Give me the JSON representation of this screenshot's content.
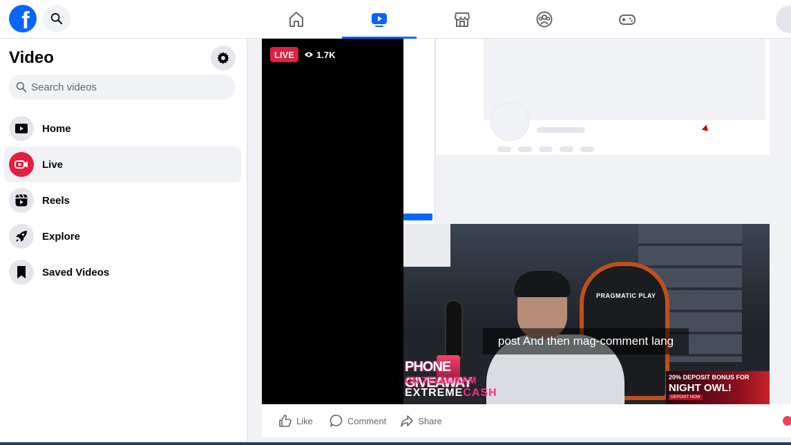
{
  "topbar": {
    "logo_letter": "f",
    "nav": [
      {
        "name": "home",
        "icon": "home-icon"
      },
      {
        "name": "video",
        "icon": "video-icon",
        "active": true
      },
      {
        "name": "marketplace",
        "icon": "marketplace-icon"
      },
      {
        "name": "groups",
        "icon": "groups-icon"
      },
      {
        "name": "gaming",
        "icon": "gaming-icon"
      }
    ],
    "accent_color": "#0866ff"
  },
  "sidebar": {
    "title": "Video",
    "search_placeholder": "Search videos",
    "items": [
      {
        "label": "Home",
        "icon": "video-home-icon"
      },
      {
        "label": "Live",
        "icon": "live-camera-icon",
        "active": true
      },
      {
        "label": "Reels",
        "icon": "reels-icon"
      },
      {
        "label": "Explore",
        "icon": "rocket-icon"
      },
      {
        "label": "Saved Videos",
        "icon": "bookmark-icon"
      }
    ]
  },
  "player": {
    "live_label": "LIVE",
    "viewer_count": "1.7K",
    "caption": "post And then mag-comment lang",
    "live_color": "#e41e3f",
    "overlay": {
      "chair_brand": "PRAGMATIC PLAY",
      "promo_line1": "PHONE GIVEAWAY",
      "promo_line2": "ON TELEGRAM",
      "promo_line3_a": "EXTREME",
      "promo_line3_b": "CASH",
      "owl_line1": "20% DEPOSIT BONUS FOR",
      "owl_line2": "NIGHT OWL!",
      "owl_line3": "DEPOSIT NOW"
    }
  },
  "actions": {
    "like": "Like",
    "comment": "Comment",
    "share": "Share"
  }
}
